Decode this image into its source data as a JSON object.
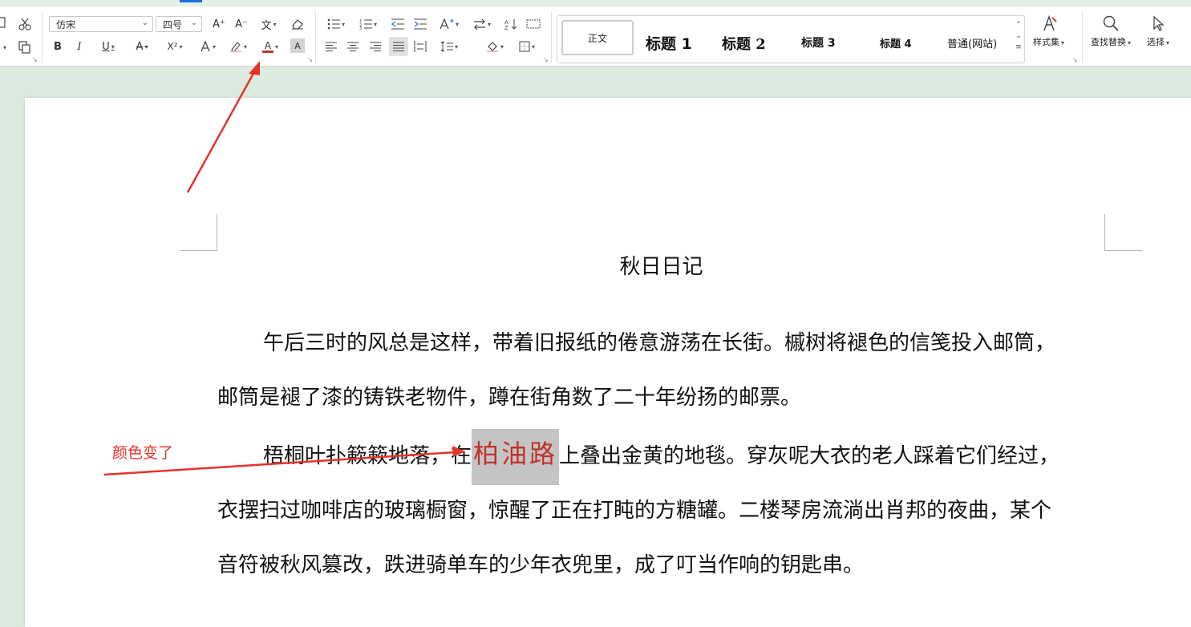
{
  "ribbon": {
    "font_name": "仿宋",
    "font_size": "四号",
    "bold_label": "B",
    "italic_label": "I",
    "underline_label": "U",
    "strike_label": "A",
    "superscript_label": "X²",
    "color_glyph": "A",
    "shade_glyph": "A",
    "grow_label": "A⁺",
    "shrink_label": "A⁻",
    "pinyin_label": "文",
    "styles": {
      "normal": "正文",
      "h1": "标题 1",
      "h2": "标题 2",
      "h3": "标题 3",
      "h4": "标题 4",
      "web": "普通(网站)"
    },
    "styleset_label": "样式集",
    "find_label": "查找替换",
    "select_label": "选择",
    "font_color_accent": "#c0332a"
  },
  "document": {
    "title": "秋日日记",
    "p1_line1": "午后三时的风总是这样，带着旧报纸的倦意游荡在长街。槭树将褪色的信笺投入邮筒，",
    "p1_line2": "邮筒是褪了漆的铸铁老物件，蹲在街角数了二十年纷扬的邮票。",
    "p2_before": "梧桐叶扑簌簌地落，在",
    "p2_selected": "柏油路",
    "p2_after": "上叠出金黄的地毯。穿灰呢大衣的老人踩着它们经过，",
    "p2_line2": "衣摆扫过咖啡店的玻璃橱窗，惊醒了正在打盹的方糖罐。二楼琴房流淌出肖邦的夜曲，某个",
    "p2_line3": "音符被秋风篡改，跌进骑单车的少年衣兜里，成了叮当作响的钥匙串。"
  },
  "annotation": {
    "text": "颜色变了",
    "color": "#e2342a"
  }
}
